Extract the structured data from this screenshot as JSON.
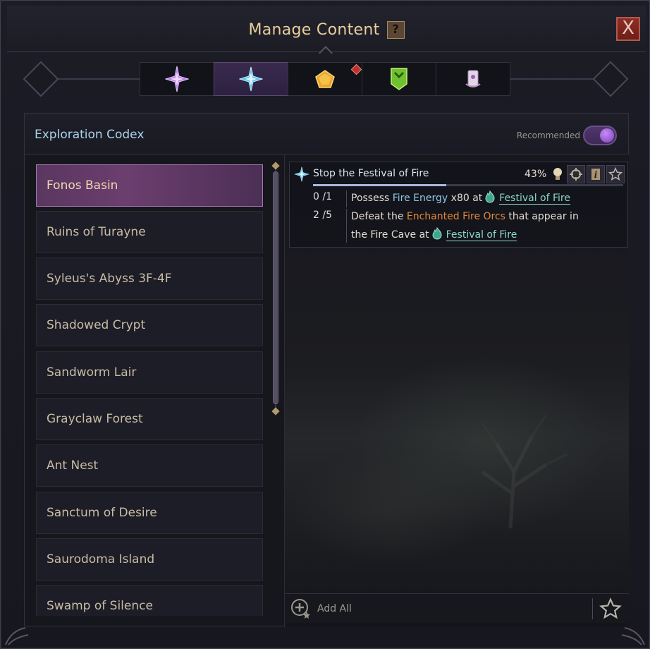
{
  "window": {
    "title": "Manage Content",
    "help_label": "?",
    "close_label": "X"
  },
  "tabs": [
    {
      "name": "tab-1",
      "icon": "purple-star-icon",
      "active": false,
      "badge": false
    },
    {
      "name": "tab-2",
      "icon": "blue-star-icon",
      "active": true,
      "badge": false
    },
    {
      "name": "tab-3",
      "icon": "gold-pentagon-icon",
      "active": false,
      "badge": true
    },
    {
      "name": "tab-4",
      "icon": "green-shield-icon",
      "active": false,
      "badge": false
    },
    {
      "name": "tab-5",
      "icon": "scroll-icon",
      "active": false,
      "badge": false
    }
  ],
  "panel": {
    "title": "Exploration Codex",
    "recommended_label": "Recommended",
    "recommended_on": true
  },
  "locations": [
    "Fonos Basin",
    "Ruins of Turayne",
    "Syleus's Abyss 3F-4F",
    "Shadowed Crypt",
    "Sandworm Lair",
    "Grayclaw Forest",
    "Ant Nest",
    "Sanctum of Desire",
    "Saurodoma Island",
    "Swamp of Silence"
  ],
  "selected_location": "Fonos Basin",
  "quest": {
    "title": "Stop the Festival of Fire",
    "percent_label": "43%",
    "progress": 0.43,
    "objectives": [
      {
        "count": "0 /1",
        "prefix": "Possess ",
        "highlight": "Fire Energy",
        "middle": " x80 at",
        "link": "Festival of Fire"
      },
      {
        "count": "2 /5",
        "prefix": "Defeat the ",
        "highlight": "Enchanted Fire Orcs",
        "middle": " that appear in",
        "line2": "the Fire Cave at",
        "link": "Festival of Fire"
      }
    ]
  },
  "footer": {
    "add_all_label": "Add All"
  },
  "colors": {
    "title": "#e8cf9d",
    "panel_title": "#a9d4ea",
    "highlight_blue": "#8fc8e4",
    "highlight_orange": "#e3883a",
    "link": "#8ad8c8",
    "active_item": "#6b3e6e"
  }
}
